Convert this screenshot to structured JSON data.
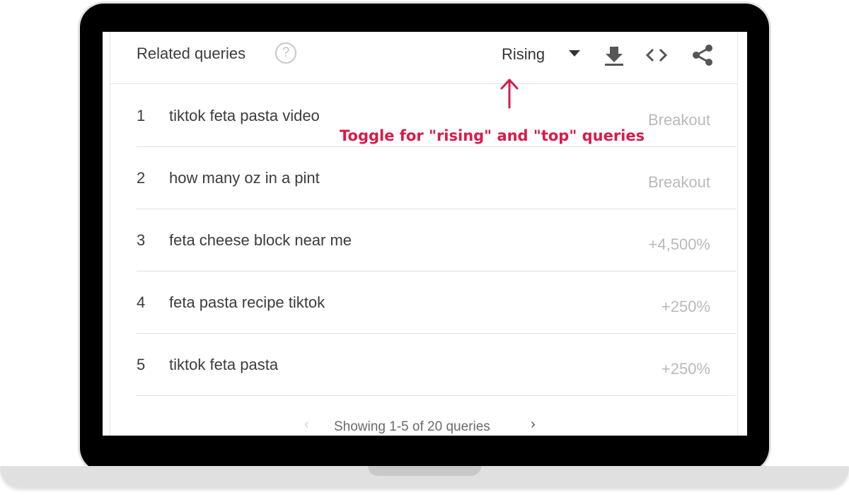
{
  "header": {
    "title": "Related queries",
    "help_icon": "?",
    "mode_selected": "Rising",
    "icons": [
      "help-circle-icon",
      "download-icon",
      "embed-code-icon",
      "share-icon"
    ]
  },
  "rows": [
    {
      "rank": "1",
      "query": "tiktok feta pasta video",
      "value": "Breakout"
    },
    {
      "rank": "2",
      "query": "how many oz in a pint",
      "value": "Breakout"
    },
    {
      "rank": "3",
      "query": "feta cheese block near me",
      "value": "+4,500%"
    },
    {
      "rank": "4",
      "query": "feta pasta recipe tiktok",
      "value": "+250%"
    },
    {
      "rank": "5",
      "query": "tiktok feta pasta",
      "value": "+250%"
    }
  ],
  "pagination": {
    "prev": "‹",
    "status": "Showing 1-5 of 20 queries",
    "next": "›"
  },
  "annotation": {
    "text": "Toggle for \"rising\" and \"top\" queries",
    "color": "#d81b4a"
  }
}
